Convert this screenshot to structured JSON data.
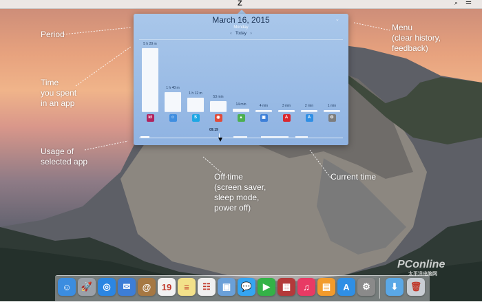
{
  "menubar": {
    "apple": "",
    "app_icon": "Z",
    "search_icon": "⌕",
    "list_icon": "☰"
  },
  "popover": {
    "date": "March 16, 2015",
    "weekday": "Monday",
    "nav": {
      "prev": "‹",
      "label": "Today",
      "next": "›"
    },
    "menu_icon": "⌄",
    "apps": [
      {
        "duration": "5 h 29 m",
        "value": 329,
        "icon": "indesign-icon",
        "glyph": "Id",
        "color": "#b0235e"
      },
      {
        "duration": "1 h 40 m",
        "value": 100,
        "icon": "finder-icon",
        "glyph": "☺",
        "color": "#3f8ee0"
      },
      {
        "duration": "1 h 12 m",
        "value": 72,
        "icon": "skype-icon",
        "glyph": "S",
        "color": "#1ea7e4"
      },
      {
        "duration": "53 min",
        "value": 53,
        "icon": "chrome-icon",
        "glyph": "◉",
        "color": "#e04b3a"
      },
      {
        "duration": "14 min",
        "value": 14,
        "icon": "maps-icon",
        "glyph": "▲",
        "color": "#4caf50"
      },
      {
        "duration": "4 min",
        "value": 4,
        "icon": "preview-icon",
        "glyph": "▣",
        "color": "#3d7fd8"
      },
      {
        "duration": "3 min",
        "value": 3,
        "icon": "acrobat-icon",
        "glyph": "A",
        "color": "#d9272e"
      },
      {
        "duration": "2 min",
        "value": 2,
        "icon": "app-store-icon",
        "glyph": "A",
        "color": "#2f8fe5"
      },
      {
        "duration": "1 min",
        "value": 1,
        "icon": "system-preferences-icon",
        "glyph": "⚙",
        "color": "#7d7d7d"
      }
    ],
    "timeline_time": "09:19"
  },
  "annotations": {
    "period": "Period",
    "time_spent": [
      "Time",
      "you spent",
      "in an app"
    ],
    "usage": [
      "Usage of",
      "selected app"
    ],
    "off_time": [
      "Off time",
      "(screen saver,",
      "sleep mode,",
      "power off)"
    ],
    "current_time": "Current time",
    "menu": [
      "Menu",
      "(clear history,",
      "feedback)"
    ]
  },
  "dock": [
    {
      "name": "finder",
      "glyph": "☺",
      "color": "#3b8de0"
    },
    {
      "name": "launchpad",
      "glyph": "🚀",
      "color": "#9aa0a8"
    },
    {
      "name": "safari",
      "glyph": "◎",
      "color": "#2b86e2"
    },
    {
      "name": "mail",
      "glyph": "✉",
      "color": "#3d7ed6"
    },
    {
      "name": "contacts",
      "glyph": "@",
      "color": "#a67843"
    },
    {
      "name": "calendar",
      "glyph": "19",
      "color": "#f2f2f2"
    },
    {
      "name": "notes",
      "glyph": "≡",
      "color": "#f3e18a"
    },
    {
      "name": "reminders",
      "glyph": "☷",
      "color": "#f0f0f0"
    },
    {
      "name": "preview",
      "glyph": "▣",
      "color": "#6aa0d8"
    },
    {
      "name": "messages",
      "glyph": "💬",
      "color": "#35a5f2"
    },
    {
      "name": "facetime",
      "glyph": "▶",
      "color": "#34b247"
    },
    {
      "name": "photo-booth",
      "glyph": "▦",
      "color": "#b33a3a"
    },
    {
      "name": "itunes",
      "glyph": "♫",
      "color": "#e83a64"
    },
    {
      "name": "ibooks",
      "glyph": "▤",
      "color": "#f29b2c"
    },
    {
      "name": "app-store",
      "glyph": "A",
      "color": "#2f8fe5"
    },
    {
      "name": "system-preferences",
      "glyph": "⚙",
      "color": "#8a8a8a"
    },
    {
      "name": "downloads",
      "glyph": "⬇",
      "color": "#5aa8e6"
    },
    {
      "name": "trash",
      "glyph": "🗑",
      "color": "#c9ced4"
    }
  ],
  "watermark": {
    "brand": "PConline",
    "sub": "太平洋电脑网"
  }
}
